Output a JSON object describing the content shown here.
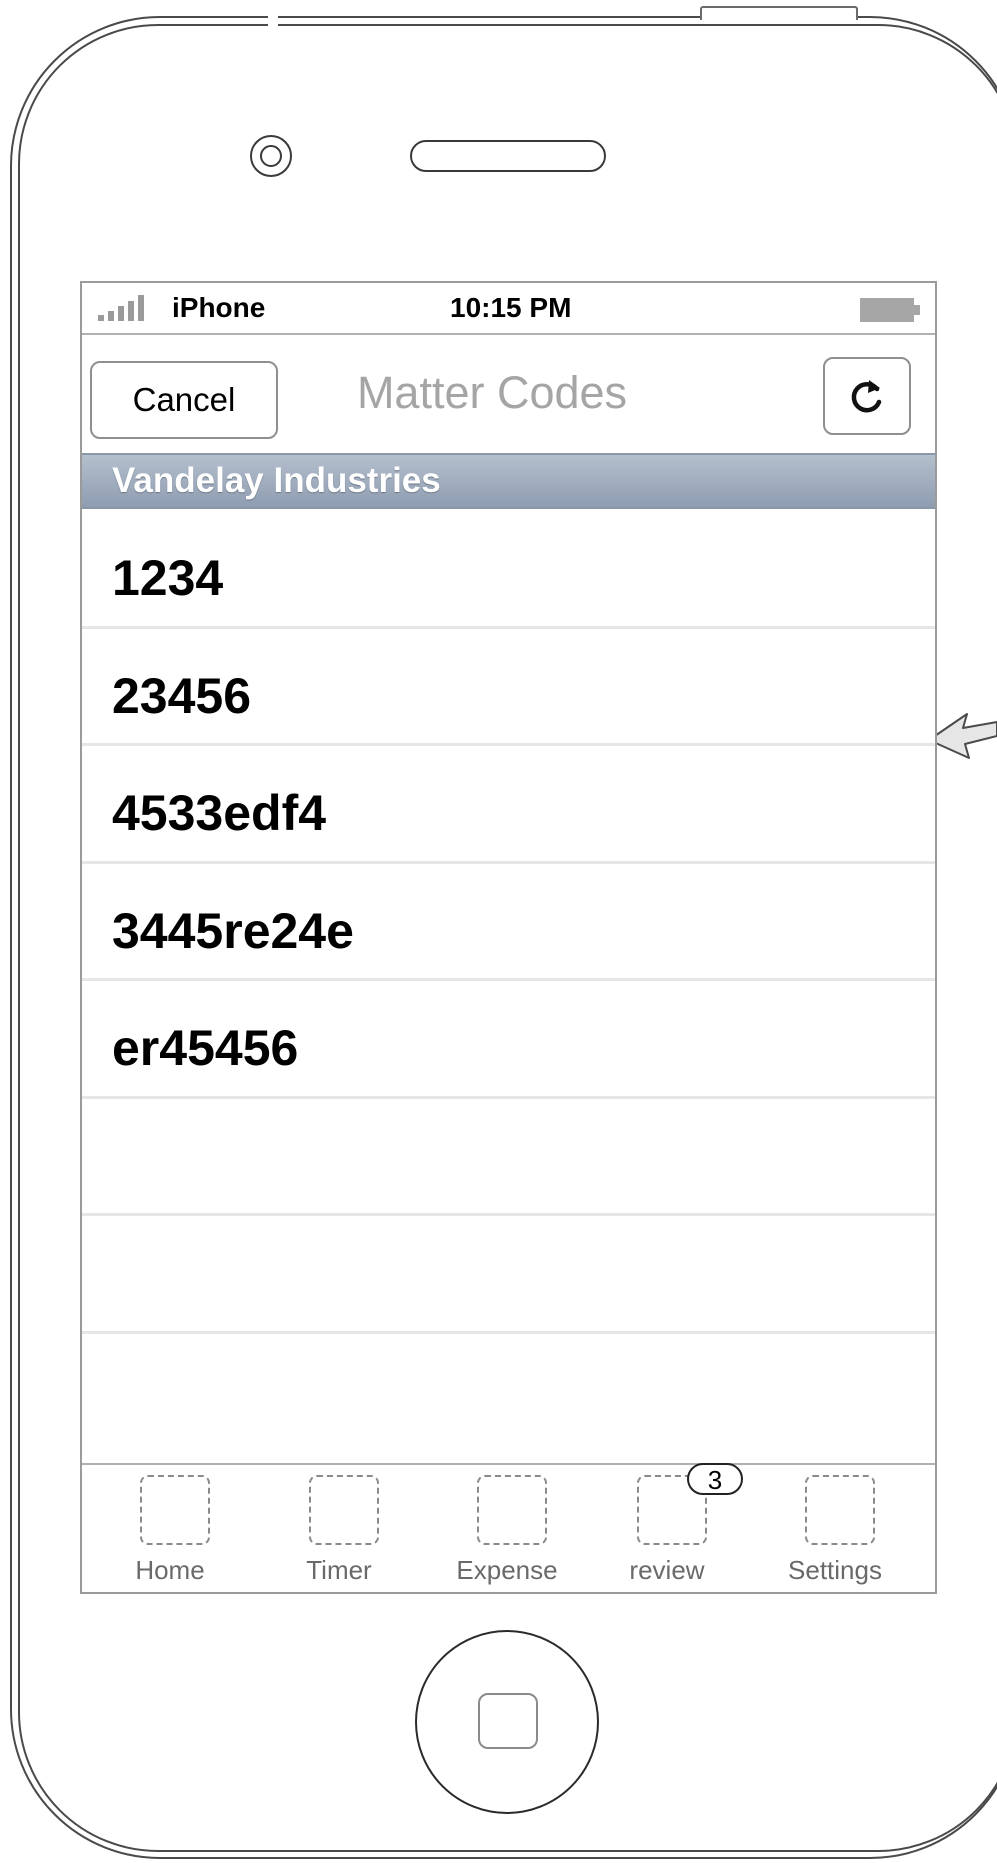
{
  "status_bar": {
    "carrier": "iPhone",
    "time": "10:15 PM"
  },
  "nav_bar": {
    "cancel_label": "Cancel",
    "title": "Matter Codes",
    "refresh_icon": "refresh-icon"
  },
  "section": {
    "title": "Vandelay Industries"
  },
  "matter_codes": [
    "1234",
    "23456",
    "4533edf4",
    "3445re24e",
    "er45456",
    "",
    "",
    ""
  ],
  "tab_bar": {
    "tabs": [
      {
        "label": "Home",
        "icon": "home-placeholder-icon"
      },
      {
        "label": "Timer",
        "icon": "timer-placeholder-icon"
      },
      {
        "label": "Expense",
        "icon": "expense-placeholder-icon"
      },
      {
        "label": "review",
        "icon": "review-placeholder-icon",
        "badge": "3"
      },
      {
        "label": "Settings",
        "icon": "settings-placeholder-icon"
      }
    ]
  },
  "colors": {
    "section_header_top": "#b4bfcd",
    "section_header_bottom": "#8f9db1",
    "nav_title": "#a5a5a5",
    "row_divider": "#e6e6e6"
  }
}
